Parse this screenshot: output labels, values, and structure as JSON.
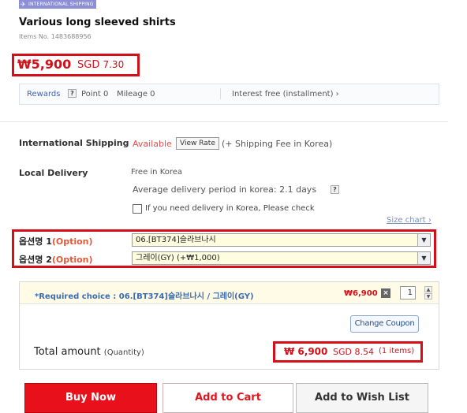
{
  "badge": {
    "text": "INTERNATIONAL SHIPPING",
    "plane": "✈"
  },
  "product": {
    "title": "Various long sleeved shirts",
    "items_no": "Items No. 1483688956",
    "price_won": "₩5,900",
    "price_sgd_label": "SGD",
    "price_sgd_value": "7.30"
  },
  "rewards": {
    "label": "Rewards",
    "help": "?",
    "point": "Point 0",
    "mileage": "Mileage 0",
    "interest": "Interest free (installment) ›"
  },
  "shipping": {
    "intl_label": "International Shipping",
    "available": "Available",
    "view_rate": "View Rate",
    "fee_note": "(+ Shipping Fee in Korea)",
    "local_label": "Local Delivery",
    "free": "Free in Korea",
    "avg_period": "Average delivery period in korea: 2.1 days",
    "avg_help": "?",
    "korea_check": "If you need delivery in Korea, Please check"
  },
  "size_chart": "Size chart ›",
  "options": [
    {
      "name": "옵션명 1",
      "tag": "(Option)",
      "value": "06.[BT374]슬라브나시"
    },
    {
      "name": "옵션명 2",
      "tag": "(Option)",
      "value": "그레이(GY) (+₩1,000)"
    }
  ],
  "order": {
    "required_choice": "*Required choice : 06.[BT374]슬라브나시 / 그레이(GY)",
    "line_price": "₩6,900",
    "delete": "×",
    "qty": "1",
    "qty_up": "▲",
    "qty_down": "▼",
    "coupon": "Change Coupon",
    "total_label": "Total amount",
    "total_qty": "(Quantity)",
    "total_won": "₩ 6,900",
    "total_sgd": "SGD 8.54",
    "total_items": "(1 items)"
  },
  "actions": {
    "buy_now": "Buy Now",
    "add_cart": "Add to Cart",
    "wish": "Add to Wish List"
  },
  "colors": {
    "accent_red": "#d3101a",
    "link_blue": "#3b6cb0",
    "badge_purple": "#8c8fd6"
  }
}
